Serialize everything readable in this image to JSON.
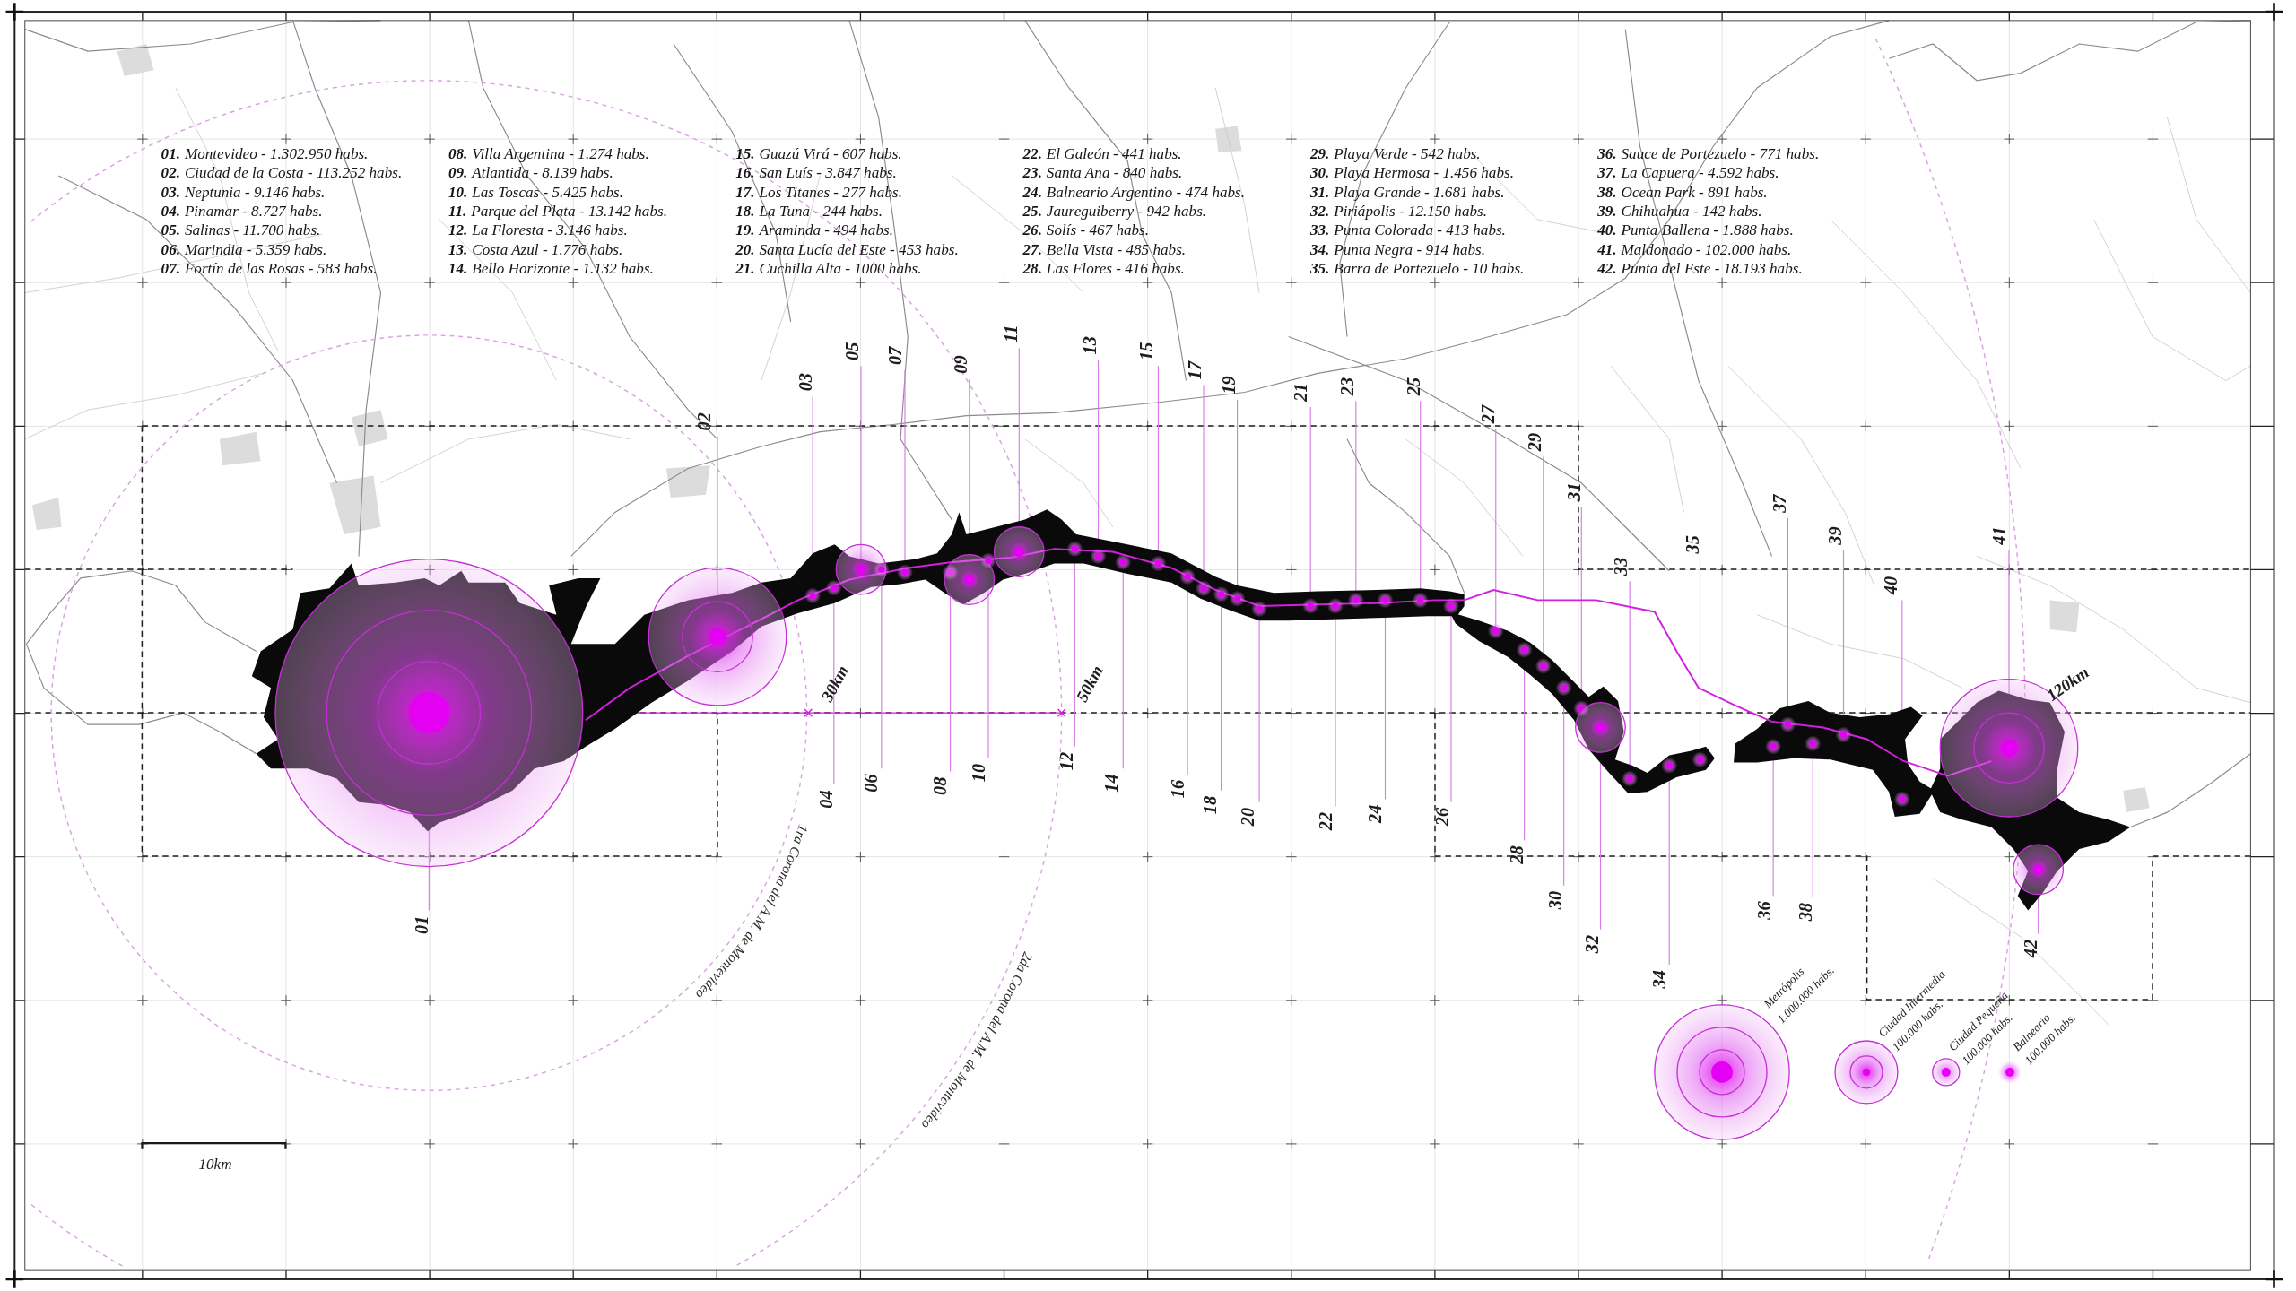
{
  "map": {
    "population_list": [
      {
        "number": "01.",
        "name": "Montevideo - 1.302.950 habs."
      },
      {
        "number": "02.",
        "name": "Ciudad de la Costa - 113.252 habs."
      },
      {
        "number": "03.",
        "name": "Neptunia - 9.146 habs."
      },
      {
        "number": "04.",
        "name": "Pinamar - 8.727 habs."
      },
      {
        "number": "05.",
        "name": "Salinas - 11.700 habs."
      },
      {
        "number": "06.",
        "name": "Marindia - 5.359 habs."
      },
      {
        "number": "07.",
        "name": "Fortín de las Rosas - 583 habs."
      },
      {
        "number": "08.",
        "name": "Villa Argentina - 1.274 habs."
      },
      {
        "number": "09.",
        "name": "Atlantida - 8.139 habs."
      },
      {
        "number": "10.",
        "name": "Las Toscas - 5.425 habs."
      },
      {
        "number": "11.",
        "name": "Parque del Plata - 13.142 habs."
      },
      {
        "number": "12.",
        "name": "La Floresta - 3.146 habs."
      },
      {
        "number": "13.",
        "name": "Costa Azul - 1.776 habs."
      },
      {
        "number": "14.",
        "name": "Bello Horizonte - 1.132 habs."
      },
      {
        "number": "15.",
        "name": "Guazú Virá - 607 habs."
      },
      {
        "number": "16.",
        "name": "San Luís - 3.847 habs."
      },
      {
        "number": "17.",
        "name": "Los Titanes - 277 habs."
      },
      {
        "number": "18.",
        "name": "La Tuna - 244 habs."
      },
      {
        "number": "19.",
        "name": "Araminda - 494 habs."
      },
      {
        "number": "20.",
        "name": "Santa Lucía del Este - 453 habs."
      },
      {
        "number": "21.",
        "name": "Cuchilla Alta - 1000 habs."
      },
      {
        "number": "22.",
        "name": "El Galeón - 441 habs."
      },
      {
        "number": "23.",
        "name": "Santa Ana - 840 habs."
      },
      {
        "number": "24.",
        "name": "Balneario Argentino - 474 habs."
      },
      {
        "number": "25.",
        "name": "Jaureguiberry - 942 habs."
      },
      {
        "number": "26.",
        "name": "Solís - 467 habs."
      },
      {
        "number": "27.",
        "name": "Bella Vista - 485 habs."
      },
      {
        "number": "28.",
        "name": "Las Flores - 416 habs."
      },
      {
        "number": "29.",
        "name": "Playa Verde - 542 habs."
      },
      {
        "number": "30.",
        "name": "Playa Hermosa - 1.456 habs."
      },
      {
        "number": "31.",
        "name": "Playa Grande - 1.681 habs."
      },
      {
        "number": "32.",
        "name": "Piriápolis - 12.150 habs."
      },
      {
        "number": "33.",
        "name": "Punta Colorada - 413 habs."
      },
      {
        "number": "34.",
        "name": "Punta Negra - 914 habs."
      },
      {
        "number": "35.",
        "name": "Barra de Portezuelo - 10 habs."
      },
      {
        "number": "36.",
        "name": "Sauce de Portezuelo - 771 habs."
      },
      {
        "number": "37.",
        "name": "La Capuera - 4.592 habs."
      },
      {
        "number": "38.",
        "name": "Ocean Park - 891 habs."
      },
      {
        "number": "39.",
        "name": "Chihuahua - 142 habs."
      },
      {
        "number": "40.",
        "name": "Punta Ballena - 1.888 habs."
      },
      {
        "number": "41.",
        "name": "Maldonado - 102.000 habs."
      },
      {
        "number": "42.",
        "name": "Punta del Este - 18.193 habs."
      }
    ],
    "markers": [
      {
        "label": "01",
        "kind": "metropolis"
      },
      {
        "label": "02",
        "kind": "intermedia"
      },
      {
        "label": "03",
        "kind": "balneario"
      },
      {
        "label": "04",
        "kind": "balneario"
      },
      {
        "label": "05",
        "kind": "pequena"
      },
      {
        "label": "06",
        "kind": "balneario"
      },
      {
        "label": "07",
        "kind": "balneario"
      },
      {
        "label": "08",
        "kind": "balneario"
      },
      {
        "label": "09",
        "kind": "pequena"
      },
      {
        "label": "10",
        "kind": "balneario"
      },
      {
        "label": "11",
        "kind": "pequena"
      },
      {
        "label": "12",
        "kind": "balneario"
      },
      {
        "label": "13",
        "kind": "balneario"
      },
      {
        "label": "14",
        "kind": "balneario"
      },
      {
        "label": "15",
        "kind": "balneario"
      },
      {
        "label": "16",
        "kind": "balneario"
      },
      {
        "label": "17",
        "kind": "balneario"
      },
      {
        "label": "18",
        "kind": "balneario"
      },
      {
        "label": "19",
        "kind": "balneario"
      },
      {
        "label": "20",
        "kind": "balneario"
      },
      {
        "label": "21",
        "kind": "balneario"
      },
      {
        "label": "22",
        "kind": "balneario"
      },
      {
        "label": "23",
        "kind": "balneario"
      },
      {
        "label": "24",
        "kind": "balneario"
      },
      {
        "label": "25",
        "kind": "balneario"
      },
      {
        "label": "26",
        "kind": "balneario"
      },
      {
        "label": "27",
        "kind": "balneario"
      },
      {
        "label": "28",
        "kind": "balneario"
      },
      {
        "label": "29",
        "kind": "balneario"
      },
      {
        "label": "30",
        "kind": "balneario"
      },
      {
        "label": "31",
        "kind": "balneario"
      },
      {
        "label": "32",
        "kind": "pequena"
      },
      {
        "label": "33",
        "kind": "balneario"
      },
      {
        "label": "34",
        "kind": "balneario"
      },
      {
        "label": "35",
        "kind": "balneario"
      },
      {
        "label": "36",
        "kind": "balneario"
      },
      {
        "label": "37",
        "kind": "balneario"
      },
      {
        "label": "38",
        "kind": "balneario"
      },
      {
        "label": "39",
        "kind": "balneario"
      },
      {
        "label": "40",
        "kind": "balneario"
      },
      {
        "label": "41",
        "kind": "intermedia"
      },
      {
        "label": "42",
        "kind": "pequena"
      }
    ],
    "rings": [
      {
        "distance": "30km",
        "caption": "1ra Corona del A.M. de Montevideo"
      },
      {
        "distance": "50km",
        "caption": "2da Corona del A.M. de Montevideo"
      },
      {
        "distance": "120km"
      }
    ],
    "size_legend": [
      {
        "kind": "metropolis",
        "name": "Metrópolis",
        "population": "1.000.000 habs."
      },
      {
        "kind": "intermedia",
        "name": "Ciudad Intermedia",
        "population": "100.000 habs."
      },
      {
        "kind": "pequena",
        "name": "Ciudad Pequeña",
        "population": "100.000 habs."
      },
      {
        "kind": "balneario",
        "name": "Balneario",
        "population": "100.000 habs."
      }
    ],
    "scale_bar": {
      "label": "10km"
    }
  }
}
